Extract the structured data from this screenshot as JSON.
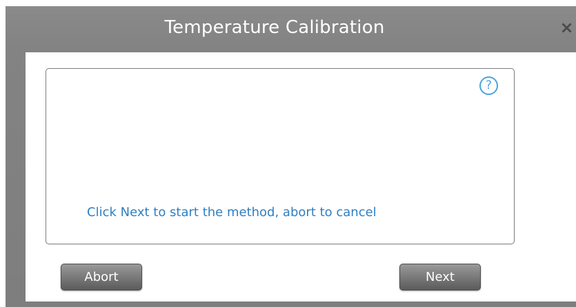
{
  "dialog": {
    "title": "Temperature Calibration",
    "close_glyph": "×",
    "help_glyph": "?",
    "message": "Click Next to start the method, abort to cancel"
  },
  "buttons": {
    "abort_label": "Abort",
    "next_label": "Next"
  },
  "colors": {
    "title_bar": "#838383",
    "message_text": "#2f7fc1",
    "help_icon": "#4aa3df",
    "button": "#6e6e6e"
  },
  "icons": {
    "close": "close-icon",
    "help": "help-icon"
  }
}
